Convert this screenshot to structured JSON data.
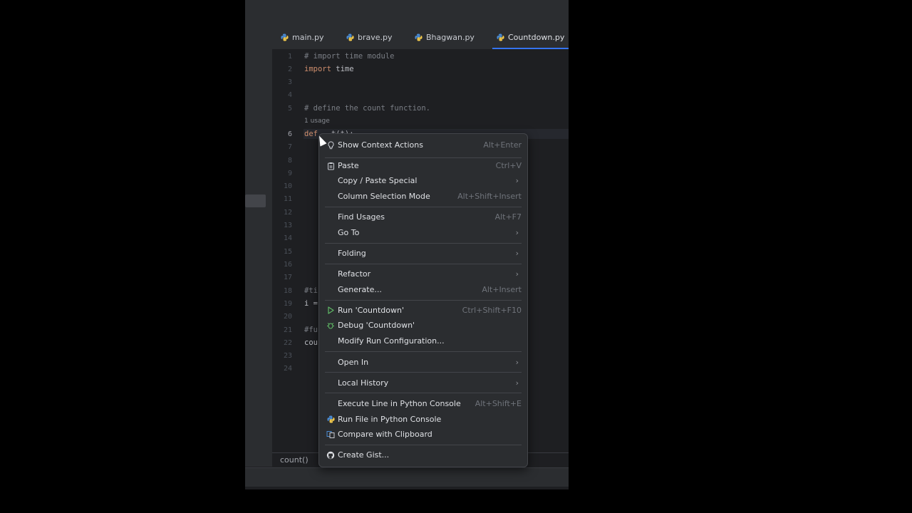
{
  "tabs": [
    {
      "label": "main.py",
      "active": false
    },
    {
      "label": "brave.py",
      "active": false
    },
    {
      "label": "Bhagwan.py",
      "active": false
    },
    {
      "label": "Countdown.py",
      "active": true
    }
  ],
  "editor": {
    "line_numbers": [
      "1",
      "2",
      "3",
      "4",
      "5",
      "6",
      "7",
      "8",
      "9",
      "10",
      "11",
      "12",
      "13",
      "14",
      "15",
      "16",
      "17",
      "18",
      "19",
      "20",
      "21",
      "22",
      "23",
      "24"
    ],
    "current_line": "6",
    "lines": {
      "l1": "# import time module",
      "l2_kw": "import",
      "l2_rest": " time",
      "l5": "# define the count function.",
      "usage_hint": "1 usage",
      "l6_kw": "def",
      "l6_rest": "   t(t):",
      "l18": "#ti",
      "l19": "i =",
      "l21": "#fu",
      "l22": "cou"
    }
  },
  "statusbar": {
    "breadcrumb": "count()"
  },
  "context_menu": {
    "items": [
      {
        "label": "Show Context Actions",
        "shortcut": "Alt+Enter",
        "icon": "lightbulb-icon"
      },
      {
        "label": "Paste",
        "shortcut": "Ctrl+V",
        "icon": "clipboard-icon"
      },
      {
        "label": "Copy / Paste Special",
        "submenu": true
      },
      {
        "label": "Column Selection Mode",
        "shortcut": "Alt+Shift+Insert"
      },
      {
        "label": "Find Usages",
        "shortcut": "Alt+F7"
      },
      {
        "label": "Go To",
        "submenu": true
      },
      {
        "label": "Folding",
        "submenu": true
      },
      {
        "label": "Refactor",
        "submenu": true
      },
      {
        "label": "Generate...",
        "shortcut": "Alt+Insert"
      },
      {
        "label": "Run 'Countdown'",
        "shortcut": "Ctrl+Shift+F10",
        "icon": "run-icon"
      },
      {
        "label": "Debug 'Countdown'",
        "icon": "bug-icon"
      },
      {
        "label": "Modify Run Configuration..."
      },
      {
        "label": "Open In",
        "submenu": true
      },
      {
        "label": "Local History",
        "submenu": true
      },
      {
        "label": "Execute Line in Python Console",
        "shortcut": "Alt+Shift+E"
      },
      {
        "label": "Run File in Python Console",
        "icon": "python-icon"
      },
      {
        "label": "Compare with Clipboard",
        "icon": "compare-icon"
      },
      {
        "label": "Create Gist...",
        "icon": "github-icon"
      }
    ],
    "submenu_glyph": "›"
  },
  "colors": {
    "accent": "#3574f0",
    "run_green": "#5fb865",
    "menu_bg": "#2b2d30",
    "editor_bg": "#1e1f22"
  }
}
